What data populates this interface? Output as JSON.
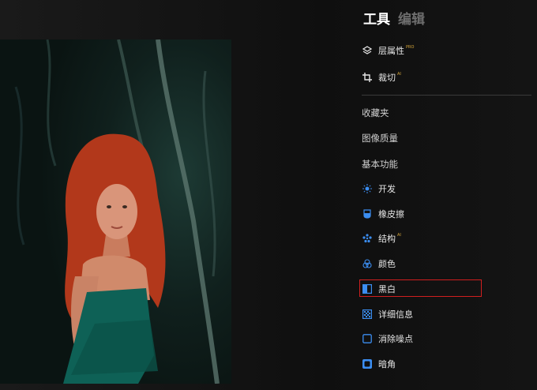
{
  "tabs": {
    "tools": "工具",
    "edit": "编辑"
  },
  "tools_top": [
    {
      "label": "层属性",
      "badge": "PRO"
    },
    {
      "label": "裁切",
      "badge": "AI"
    }
  ],
  "sections": {
    "favorites": "收藏夹",
    "image_quality": "图像质量",
    "basic": "基本功能"
  },
  "basic_items": [
    {
      "label": "开发",
      "badge": ""
    },
    {
      "label": "橡皮擦",
      "badge": ""
    },
    {
      "label": "结构",
      "badge": "AI"
    },
    {
      "label": "颜色",
      "badge": ""
    },
    {
      "label": "黑白",
      "badge": ""
    },
    {
      "label": "详细信息",
      "badge": ""
    },
    {
      "label": "消除噪点",
      "badge": ""
    },
    {
      "label": "暗角",
      "badge": ""
    }
  ],
  "colors": {
    "icon_blue": "#3b8df0",
    "badge_gold": "#d4a53a",
    "highlight_red": "#d01f1f"
  }
}
